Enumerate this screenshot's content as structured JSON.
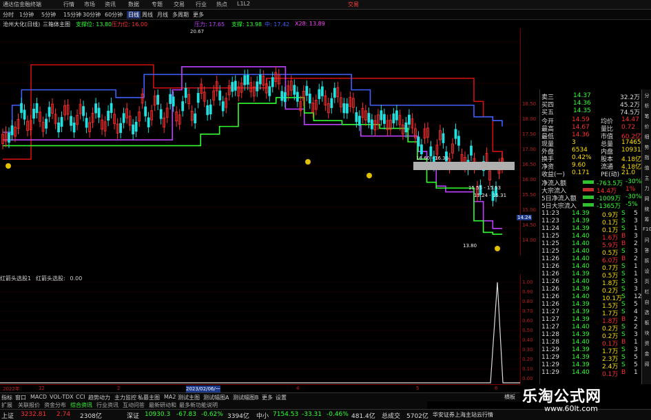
{
  "window": {
    "title": "通达信金融终端",
    "menus": [
      "行情",
      "市场",
      "资讯",
      "数据",
      "专题",
      "交易",
      "行业",
      "热点",
      "L1L2"
    ],
    "trade_btn": "交易"
  },
  "toolbar": {
    "items": [
      "分时",
      "1分钟",
      "5分钟",
      "15分钟",
      "30分钟",
      "60分钟",
      "日线",
      "周线",
      "月线",
      "多周期",
      "更多"
    ],
    "active": "日线"
  },
  "legend": {
    "name": "沧州大化(日线)",
    "indicator": "三箱体主图",
    "support": "支撑位: 13.80",
    "pressure": "压力位: 16.00",
    "pressure2": "压力: 17.65",
    "support2": "支撑: 13.98",
    "mid": "中: 17.42",
    "upper": "X28: 13.89"
  },
  "price_labels": {
    "high": "20.67",
    "low": "13.80",
    "band1": "16.60 - 16.30",
    "band2": "15.55 - 15.53",
    "band3": "15.24 - 15.31",
    "current": "14.24"
  },
  "y_axis_main": [
    "18.50",
    "18.00",
    "17.50",
    "17.00",
    "16.50",
    "16.00",
    "15.50",
    "15.00",
    "14.50",
    "14.00"
  ],
  "y_axis_sub": [
    "1.00",
    "0.90",
    "0.80",
    "0.70",
    "0.60",
    "0.50",
    "0.40",
    "0.30",
    "0.20",
    "0.10",
    "0.00"
  ],
  "sub_legend": [
    "红箭头选股1",
    "红箭头选股:",
    "0.00"
  ],
  "date_bar": {
    "labels": [
      "2022年",
      "12",
      "2",
      "3",
      "2023/02/06/一",
      "4",
      "5",
      "6"
    ]
  },
  "tabs": [
    "指标",
    "窗口",
    "MACD",
    "VOL-TDX",
    "CCI",
    "趋势动力",
    "主力监控",
    "私募主图",
    "MA2",
    "测试主图",
    "测试幅图A",
    "测试幅图B",
    "更多",
    "设置"
  ],
  "tabs2": [
    "扩展",
    "关联报价",
    "资金分布",
    "综合资讯",
    "行业资讯",
    "互动问答",
    "最新研动和",
    "最多新功能说明"
  ],
  "mode_label": "横板",
  "quote_top": [
    {
      "label": "卖三",
      "price": "14.37",
      "vol": "32.2万"
    },
    {
      "label": "买四",
      "price": "14.36",
      "vol": "45.2万"
    },
    {
      "label": "买五",
      "price": "14.35",
      "vol": "74.5万"
    }
  ],
  "quote_stats": [
    {
      "l1": "今开",
      "v1": "14.59",
      "l2": "均价",
      "v2": "14.47"
    },
    {
      "l1": "最高",
      "v1": "14.67",
      "l2": "量比",
      "v2": "0.72"
    },
    {
      "l1": "最低",
      "v1": "14.36",
      "l2": "市值",
      "v2": "60.2亿"
    },
    {
      "l1": "现量",
      "v1": "3",
      "l2": "总量",
      "v2": "17465"
    },
    {
      "l1": "外盘",
      "v1": "6534",
      "l2": "内盘",
      "v2": "10931"
    },
    {
      "l1": "换手",
      "v1": "0.42%",
      "l2": "股本",
      "v2": "4.18亿"
    },
    {
      "l1": "净资",
      "v1": "9.60",
      "l2": "流通",
      "v2": "4.18亿"
    },
    {
      "l1": "收益(一)",
      "v1": "0.171",
      "l2": "PE(动)",
      "v2": "21.0"
    }
  ],
  "fund_flow": [
    {
      "label": "净流入额",
      "value": "-763.5万",
      "pct": "-30%"
    },
    {
      "label": "大宗流入",
      "value": "14.4万",
      "pct": "1%"
    },
    {
      "label": "5日净流入额",
      "value": "-1009万",
      "pct": "-30%"
    },
    {
      "label": "5日大宗流入",
      "value": "-1365万",
      "pct": "-5%"
    }
  ],
  "ticks": [
    {
      "t": "11:23",
      "p": "14.39",
      "v": "0.9万",
      "s": "S",
      "n": "5"
    },
    {
      "t": "11:23",
      "p": "14.39",
      "v": "0.1万",
      "s": "S",
      "n": "3"
    },
    {
      "t": "11:24",
      "p": "14.39",
      "v": "0.1万",
      "s": "S",
      "n": "1"
    },
    {
      "t": "11:25",
      "p": "14.40",
      "v": "1.6万",
      "s": "B",
      "n": "3"
    },
    {
      "t": "11:25",
      "p": "14.40",
      "v": "5.9万",
      "s": "B",
      "n": "2"
    },
    {
      "t": "11:25",
      "p": "14.40",
      "v": "0.5万",
      "s": "S",
      "n": "3"
    },
    {
      "t": "11:26",
      "p": "14.40",
      "v": "6.0万",
      "s": "B",
      "n": "2"
    },
    {
      "t": "11:26",
      "p": "14.40",
      "v": "0.7万",
      "s": "S",
      "n": "1"
    },
    {
      "t": "11:26",
      "p": "14.39",
      "v": "0.5万",
      "s": "S",
      "n": "1"
    },
    {
      "t": "11:26",
      "p": "14.40",
      "v": "1.8万",
      "s": "S",
      "n": "3"
    },
    {
      "t": "11:26",
      "p": "14.39",
      "v": "0.2万",
      "s": "S",
      "n": "3"
    },
    {
      "t": "11:26",
      "p": "14.40",
      "v": "10.1万",
      "s": "S",
      "n": "12"
    },
    {
      "t": "11:26",
      "p": "14.39",
      "v": "1.5万",
      "s": "S",
      "n": "5"
    },
    {
      "t": "11:27",
      "p": "14.39",
      "v": "1.7万",
      "s": "S",
      "n": "4"
    },
    {
      "t": "11:27",
      "p": "14.39",
      "v": "1.8万",
      "s": "B",
      "n": "2"
    },
    {
      "t": "11:27",
      "p": "14.40",
      "v": "0.2万",
      "s": "S",
      "n": "2"
    },
    {
      "t": "11:28",
      "p": "14.39",
      "v": "0.2万",
      "s": "S",
      "n": "3"
    },
    {
      "t": "11:28",
      "p": "14.40",
      "v": "0.1万",
      "s": "B",
      "n": "1"
    },
    {
      "t": "11:29",
      "p": "14.39",
      "v": "1.7万",
      "s": "S",
      "n": "3"
    },
    {
      "t": "11:29",
      "p": "14.39",
      "v": "2.3万",
      "s": "S",
      "n": "5"
    },
    {
      "t": "11:29",
      "p": "14.39",
      "v": "2.4万",
      "s": "S",
      "n": "5"
    },
    {
      "t": "11:29",
      "p": "14.40",
      "v": "0.1万",
      "s": "B",
      "n": "1"
    }
  ],
  "sidebar_icons": [
    "分",
    "析",
    "笔",
    "价",
    "细",
    "势",
    "指",
    "值",
    "主",
    "力",
    "网",
    "统",
    "筹",
    "F10",
    "问",
    "答",
    "拆",
    "设",
    "页",
    "栏",
    "自",
    "选",
    "板",
    "块",
    "资",
    "金",
    "阅"
  ],
  "statusbar": {
    "sh_label": "上证",
    "sh_val": "3232.81",
    "sh_chg": "2.74",
    "sh_amt": "2308亿",
    "sz_label": "深证",
    "sz_val": "10930.3",
    "sz_chg": "-67.83",
    "sz_pct": "-0.62%",
    "sz_amt": "3394亿",
    "zx_label": "中小",
    "zx_val": "7154.53",
    "zx_chg": "-33.31",
    "zx_pct": "-0.46%",
    "zx_amt": "481.4亿",
    "total_label": "总成交",
    "total_val": "5702亿",
    "broker": "华安证券上海主站云行情"
  },
  "watermark": {
    "title": "乐淘公式网",
    "url": "www.60lt.com"
  },
  "colors": {
    "up": "#ff3030",
    "down": "#20e0e0",
    "green": "#30ff30",
    "blue": "#4060ff",
    "purple": "#c040ff",
    "red_line": "#d01010",
    "axis": "#c02020"
  },
  "chart_series": {
    "red_line": [
      16.1,
      16.1,
      16.1,
      18.55,
      18.55,
      18.55,
      18.55,
      18.55,
      18.55,
      18.55,
      18.55,
      18.55,
      18.55,
      18.55,
      18.55,
      18.55,
      17.95,
      17.95,
      17.95,
      17.95,
      17.95,
      17.95,
      17.95,
      17.95,
      17.95,
      17.95,
      17.95,
      17.95,
      18.2,
      18.2,
      18.2,
      18.2,
      18.2,
      18.2,
      18.2,
      18.2,
      18.2,
      18.2,
      18.2,
      18.2,
      18.2,
      18.2,
      18.2,
      18.2,
      18.2,
      18.2,
      18.2,
      18.2,
      18.2,
      18.2,
      17.6,
      17.2,
      16.3,
      15.9
    ],
    "blue_line": [
      16.8,
      17.5,
      17.9,
      17.9,
      17.9,
      17.9,
      17.9,
      17.9,
      17.9,
      17.9,
      17.9,
      17.9,
      17.7,
      17.7,
      17.7,
      18.3,
      18.3,
      18.3,
      18.3,
      18.3,
      18.3,
      18.3,
      18.3,
      18.3,
      18.3,
      18.3,
      18.3,
      18.3,
      18.3,
      18.3,
      18.3,
      18.3,
      18.3,
      18.3,
      18.3,
      18.3,
      18.3,
      17.9,
      17.9,
      17.5,
      17.5,
      17.5,
      17.5,
      17.5,
      17.5,
      17.5,
      17.5,
      17.5,
      17.5,
      17.5,
      17.2,
      17.2,
      17.1,
      16.95
    ],
    "purple_line": [
      16.6,
      16.6,
      16.6,
      16.6,
      16.6,
      16.6,
      16.6,
      16.6,
      16.6,
      16.6,
      16.6,
      16.6,
      16.6,
      16.6,
      16.6,
      16.6,
      16.6,
      16.6,
      17.9,
      18.5,
      18.5,
      18.5,
      18.5,
      18.5,
      18.5,
      18.5,
      18.5,
      18.5,
      18.5,
      18.5,
      17.4,
      17.4,
      17.0,
      17.0,
      17.0,
      17.0,
      17.0,
      17.0,
      16.7,
      16.7,
      16.7,
      16.7,
      16.7,
      16.7,
      16.3,
      15.9,
      15.4,
      15.25,
      15.25,
      15.25,
      15.0,
      14.5,
      14.3,
      14.3
    ],
    "green_line": [
      16.45,
      16.45,
      16.45,
      16.45,
      16.45,
      16.45,
      16.45,
      16.45,
      16.45,
      16.45,
      16.45,
      16.45,
      16.45,
      16.45,
      16.45,
      16.45,
      16.45,
      16.45,
      16.45,
      16.45,
      16.45,
      16.75,
      16.75,
      16.95,
      16.95,
      17.55,
      17.55,
      17.55,
      17.55,
      17.7,
      17.7,
      17.7,
      17.3,
      17.1,
      17.1,
      17.1,
      17.0,
      17.0,
      17.0,
      17.0,
      16.9,
      16.9,
      16.9,
      16.55,
      16.1,
      15.5,
      15.35,
      15.35,
      15.35,
      15.35,
      14.5,
      14.2,
      14.15,
      14.15
    ]
  }
}
